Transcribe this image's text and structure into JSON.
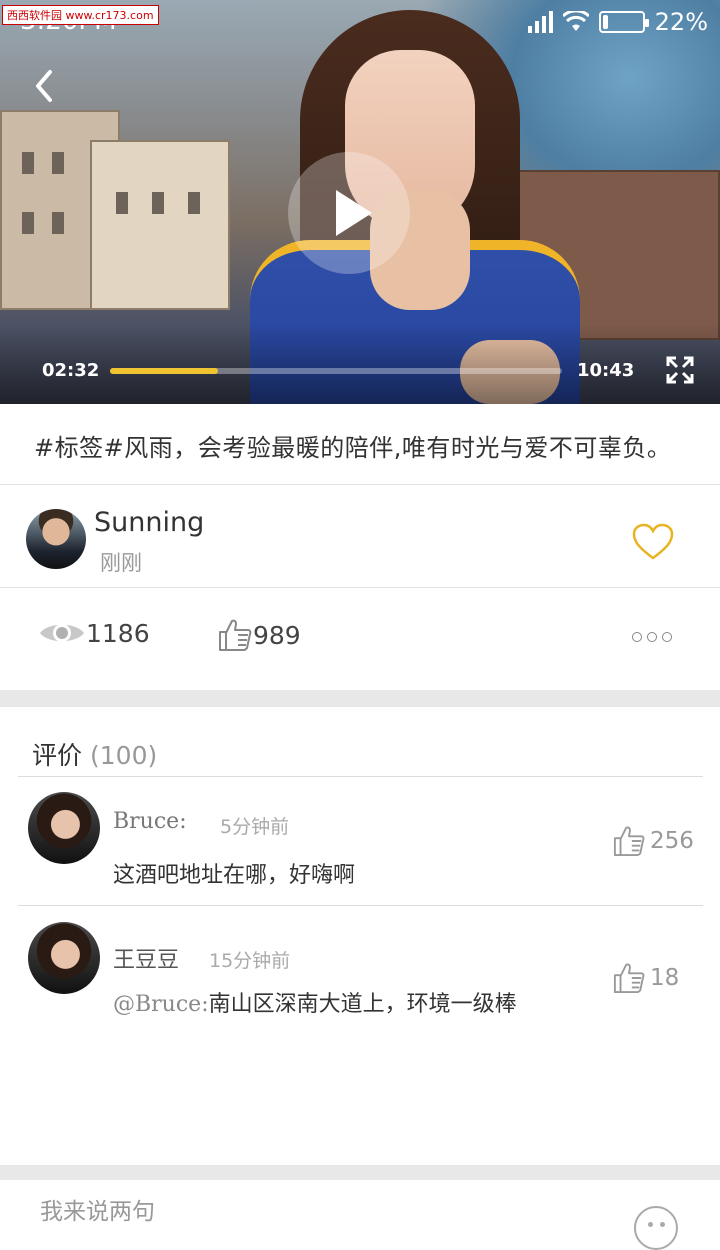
{
  "status_bar": {
    "time": "3:20PM",
    "watermark": "西西软件园 www.cr173.com",
    "battery_percent": "22%",
    "battery_level": 0.22
  },
  "video": {
    "current_time": "02:32",
    "duration": "10:43",
    "progress": 0.24,
    "accent_color": "#f0c330"
  },
  "post": {
    "caption": "#标签#风雨，会考验最暖的陪伴,唯有时光与爱不可辜负。"
  },
  "author": {
    "name": "Sunning",
    "time": "刚刚"
  },
  "stats": {
    "views": "1186",
    "likes": "989"
  },
  "comments": {
    "title": "评价",
    "count": "(100)",
    "items": [
      {
        "user": "Bruce:",
        "time": "5分钟前",
        "text": "这酒吧地址在哪，好嗨啊",
        "mention": "",
        "likes": "256"
      },
      {
        "user": "王豆豆",
        "time": "15分钟前",
        "mention": "@Bruce:",
        "text": "南山区深南大道上，环境一级棒",
        "likes": "18"
      }
    ]
  },
  "input": {
    "placeholder": "我来说两句"
  },
  "icons": {
    "back": "chevron-left-icon",
    "play": "play-icon",
    "fullscreen": "fullscreen-icon",
    "heart": "heart-icon",
    "views": "eye-icon",
    "like": "thumbs-up-icon",
    "more": "more-icon",
    "emoji": "emoji-icon"
  }
}
